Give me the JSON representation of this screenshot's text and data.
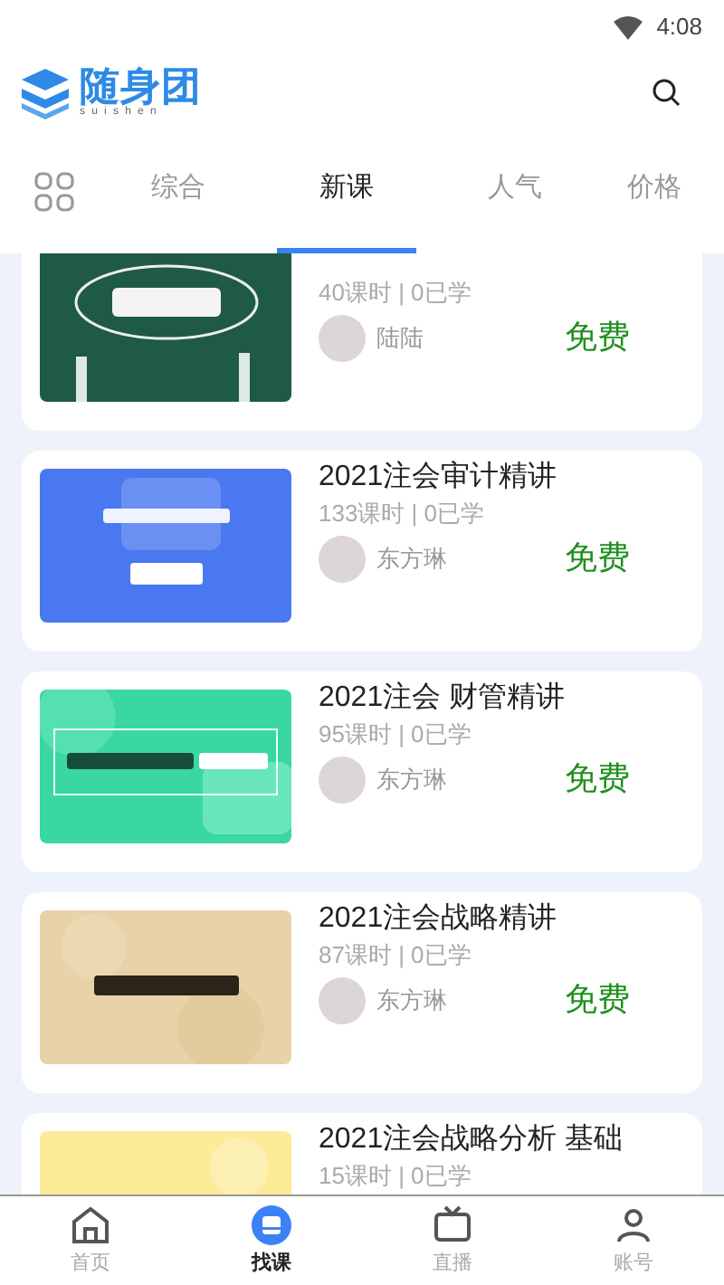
{
  "status_bar": {
    "time": "4:08"
  },
  "header": {
    "logo_text": "随身团",
    "logo_subtext": "suishen"
  },
  "tabs": [
    {
      "label": "综合",
      "selected": false
    },
    {
      "label": "新课",
      "selected": true
    },
    {
      "label": "人气",
      "selected": false
    },
    {
      "label": "价格",
      "selected": false
    }
  ],
  "courses": [
    {
      "meta": "40课时 | 0已学",
      "teacher": "陆陆",
      "price": "免费"
    },
    {
      "title": "2021注会审计精讲",
      "meta": "133课时 | 0已学",
      "teacher": "东方琳",
      "price": "免费"
    },
    {
      "title": "2021注会 财管精讲",
      "meta": "95课时 | 0已学",
      "teacher": "东方琳",
      "price": "免费"
    },
    {
      "title": "2021注会战略精讲",
      "meta": "87课时 | 0已学",
      "teacher": "东方琳",
      "price": "免费"
    },
    {
      "title": "2021注会战略分析 基础",
      "meta": "15课时 | 0已学"
    }
  ],
  "bottom_nav": [
    {
      "kind": "home",
      "label": "首页",
      "selected": false
    },
    {
      "kind": "courses",
      "label": "找课",
      "selected": true
    },
    {
      "kind": "live",
      "label": "直播",
      "selected": false
    },
    {
      "kind": "account",
      "label": "账号",
      "selected": false
    }
  ]
}
